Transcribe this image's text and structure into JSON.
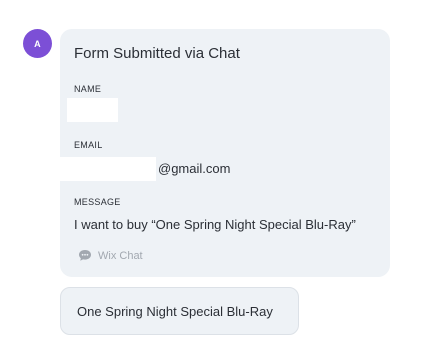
{
  "avatar": {
    "initial": "A",
    "color": "#7C4FD6"
  },
  "form_card": {
    "title": "Form Submitted via Chat",
    "fields": [
      {
        "label": "NAME",
        "value": ""
      },
      {
        "label": "EMAIL",
        "value": "@gmail.com"
      },
      {
        "label": "MESSAGE",
        "value": "I want to buy “One Spring Night Special Blu-Ray”"
      }
    ],
    "source": {
      "icon": "chat-bubble-icon",
      "label": "Wix Chat"
    }
  },
  "reply_bubble": {
    "text": "One Spring Night Special Blu-Ray"
  },
  "colors": {
    "bubble_bg": "#EEF2F6",
    "text": "#2B2F36",
    "muted": "#A2A8B0"
  }
}
